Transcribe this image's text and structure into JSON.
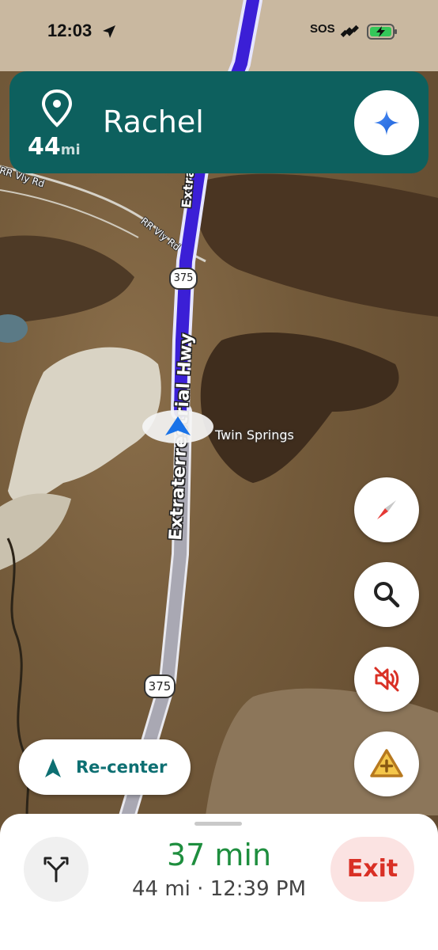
{
  "status_bar": {
    "time": "12:03",
    "sos_label": "SOS"
  },
  "navigation_banner": {
    "distance_value": "44",
    "distance_unit": "mi",
    "destination": "Rachel"
  },
  "map": {
    "highway_label": "Extraterrestrial Hwy",
    "highway_label_upper": "Extra",
    "highway_shield": "375",
    "side_road_label_1": "RR Vly Rd",
    "side_road_label_2": "RR Vly Rd",
    "place_label": "Twin Springs",
    "route_color": "#3b1fd6"
  },
  "controls": {
    "recenter_label": "Re-center",
    "icons": [
      "compass-icon",
      "search-icon",
      "mute-icon",
      "report-hazard-icon"
    ]
  },
  "bottom_sheet": {
    "eta_duration": "37 min",
    "trip_meta": "44 mi · 12:39 PM",
    "exit_label": "Exit"
  }
}
